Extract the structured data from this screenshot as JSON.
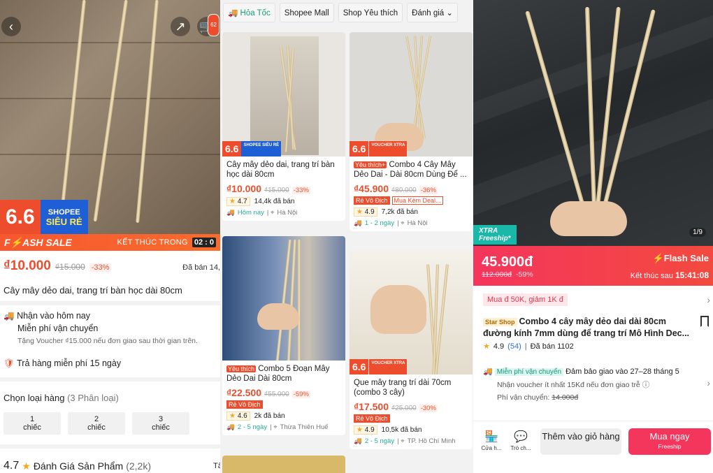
{
  "panel1": {
    "cart_count": "62",
    "promo_number": "6.6",
    "promo_top": "SHOPEE",
    "promo_bottom": "SIÊU RẺ",
    "flash_label": "F⚡ASH SALE",
    "ends_label": "KẾT THÚC TRONG",
    "countdown": "02 : 0",
    "price": "₫10.000",
    "old_price": "₫15.000",
    "discount": "-33%",
    "sold": "Đã bán 14,",
    "title": "Cây mây dẻo dai, trang trí bàn học dài 80cm",
    "delivery": "Nhận vào hôm nay",
    "free_ship": "Miễn phí vận chuyển",
    "voucher_note": "Tặng Voucher ₫15.000 nếu đơn giao sau thời gian trên.",
    "return": "Trả hàng miễn phí 15 ngày",
    "variant_title": "Chọn loại hàng",
    "variant_count": "(3 Phân loại)",
    "variants": [
      {
        "num": "1",
        "label": "chiếc"
      },
      {
        "num": "2",
        "label": "chiếc"
      },
      {
        "num": "3",
        "label": "chiếc"
      }
    ],
    "rating": "4.7",
    "rating_label": "Đánh Giá Sản Phẩm",
    "rating_count": "(2,2k)",
    "rating_more": "Tấ"
  },
  "panel2": {
    "filters": [
      "Hỏa Tốc",
      "Shopee Mall",
      "Shop Yêu thích",
      "Đánh giá"
    ],
    "products": [
      {
        "badge": "6.6",
        "badge_label": "SHOPEE SIÊU RẺ",
        "tag": "",
        "title": "Cây mây dẻo dai, trang trí bàn học dài 80cm",
        "price": "₫10.000",
        "old": "₫15.000",
        "disc": "-33%",
        "vouchers": [],
        "rating": "4.7",
        "sold": "14,4k đã bán",
        "ship": "Hôm nay",
        "loc": "Hà Nội"
      },
      {
        "badge": "6.6",
        "badge_label": "VOUCHER XTRA",
        "tag": "Yêu thích+",
        "title": "Combo 4 Cây Mây Dẻo Dai - Dài 80cm Dùng Để ...",
        "price": "₫45.900",
        "old": "₫80.000",
        "disc": "-36%",
        "vouchers": [
          "Rẻ Vô Địch",
          "Mua Kèm Deal..."
        ],
        "rating": "4.9",
        "sold": "7,2k đã bán",
        "ship": "1 - 2 ngày",
        "loc": "Hà Nội"
      },
      {
        "badge": "",
        "badge_label": "",
        "tag": "Yêu thích",
        "title": "Combo 5 Đoạn Mây Dẻo Dai Dài 80cm",
        "price": "₫22.500",
        "old": "₫55.000",
        "disc": "-59%",
        "vouchers": [
          "Rẻ Vô Địch"
        ],
        "rating": "4.6",
        "sold": "2k đã bán",
        "ship": "2 - 5 ngày",
        "loc": "Thừa Thiên Huế"
      },
      {
        "badge": "6.6",
        "badge_label": "VOUCHER XTRA",
        "tag": "",
        "title": "Que mây trang trí dài 70cm (combo 3 cây)",
        "price": "₫17.500",
        "old": "₫25.000",
        "disc": "-30%",
        "vouchers": [
          "Rẻ Vô Địch"
        ],
        "rating": "4.9",
        "sold": "10,5k đã bán",
        "ship": "2 - 5 ngày",
        "loc": "TP. Hồ Chí Minh"
      }
    ]
  },
  "panel3": {
    "xtra_top": "XTRA",
    "xtra_bottom": "Freeship*",
    "page_indicator": "1/9",
    "price": "45.900đ",
    "old_price": "112.000đ",
    "discount": "-59%",
    "flash_label": "Flash Sale",
    "ends_label": "Kết thúc sau",
    "ends_time": "15:41:08",
    "voucher": "Mua đ 50K, giảm 1K đ",
    "shop_tag": "Star Shop",
    "title": "Combo 4 cây mây dẻo dai dài 80cm đường kính 7mm dùng để trang trí Mô Hình Dec...",
    "rating": "4.9",
    "rating_count": "(54)",
    "sold": "Đã bán 1102",
    "freeship_tag": "Miễn phí vận chuyển",
    "delivery": "Đảm bảo giao vào 27–28 tháng 5",
    "voucher_note": "Nhận voucher ít nhất 15Kđ nếu đơn giao trễ",
    "ship_fee_label": "Phí vận chuyển:",
    "ship_fee": "14.000đ",
    "shop_label": "Cửa h...",
    "chat_label": "Trò ch...",
    "add_cart": "Thêm vào giỏ hàng",
    "buy_now": "Mua ngay",
    "buy_sub": "Freeship"
  }
}
